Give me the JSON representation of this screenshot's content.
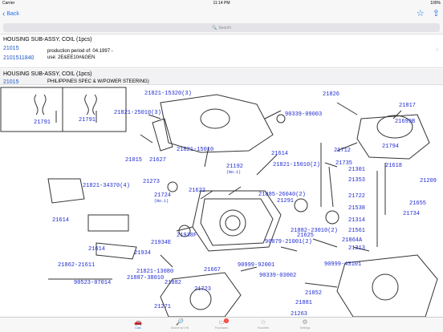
{
  "status": {
    "carrier": "Carrier",
    "time": "11:14 PM",
    "battery": "100%"
  },
  "nav": {
    "back_label": "Back"
  },
  "search": {
    "placeholder": "Search"
  },
  "rows": [
    {
      "title": "HOUSING SUB-ASSY, COIL (1pcs)",
      "code1": "21015",
      "code2": "2101511840",
      "note1": "production period of: 04.1997 -",
      "note2": "use: 2E&EE10#&GEN"
    },
    {
      "title": "HOUSING SUB-ASSY, COIL (1pcs)",
      "code1": "21015",
      "note1": "PHILIPPINES SPEC & W/POWER STEERING)"
    }
  ],
  "diagram": {
    "labels": [
      "21791",
      "21791",
      "21821-15320(3)",
      "21826",
      "21821-25010(3)",
      "21817",
      "90339-09003",
      "21699B",
      "21015",
      "21627",
      "21821-15010",
      "21614",
      "21712",
      "21794",
      "21192",
      "(No.1)",
      "21821-15010(2)",
      "21735",
      "21618",
      "21301",
      "21273",
      "21821-34370(4)",
      "21724",
      "(No.1)",
      "21622",
      "21885-26040(2)",
      "21291",
      "21353",
      "21209",
      "21722",
      "21655",
      "21614",
      "21625",
      "21538",
      "21734",
      "21314",
      "21614",
      "21934E",
      "21938F",
      "21882-23010(2)",
      "90079-21001(2)",
      "21561",
      "21864A",
      "21934",
      "21313",
      "21862-21611",
      "21821-13080",
      "21667",
      "90999-92001",
      "90999-43101",
      "21887-38010",
      "90523-07014",
      "21882",
      "21723",
      "90339-03002",
      "21852",
      "21271",
      "21881",
      "21263"
    ]
  },
  "tabs": [
    {
      "label": "Cars",
      "icon": "car-icon",
      "active": true
    },
    {
      "label": "Search by VIN",
      "icon": "vin-search-icon",
      "active": false
    },
    {
      "label": "Purchases",
      "icon": "purchases-icon",
      "active": false,
      "badge": "1"
    },
    {
      "label": "Favorites",
      "icon": "star-icon",
      "active": false
    },
    {
      "label": "Settings",
      "icon": "gear-icon",
      "active": false
    }
  ]
}
